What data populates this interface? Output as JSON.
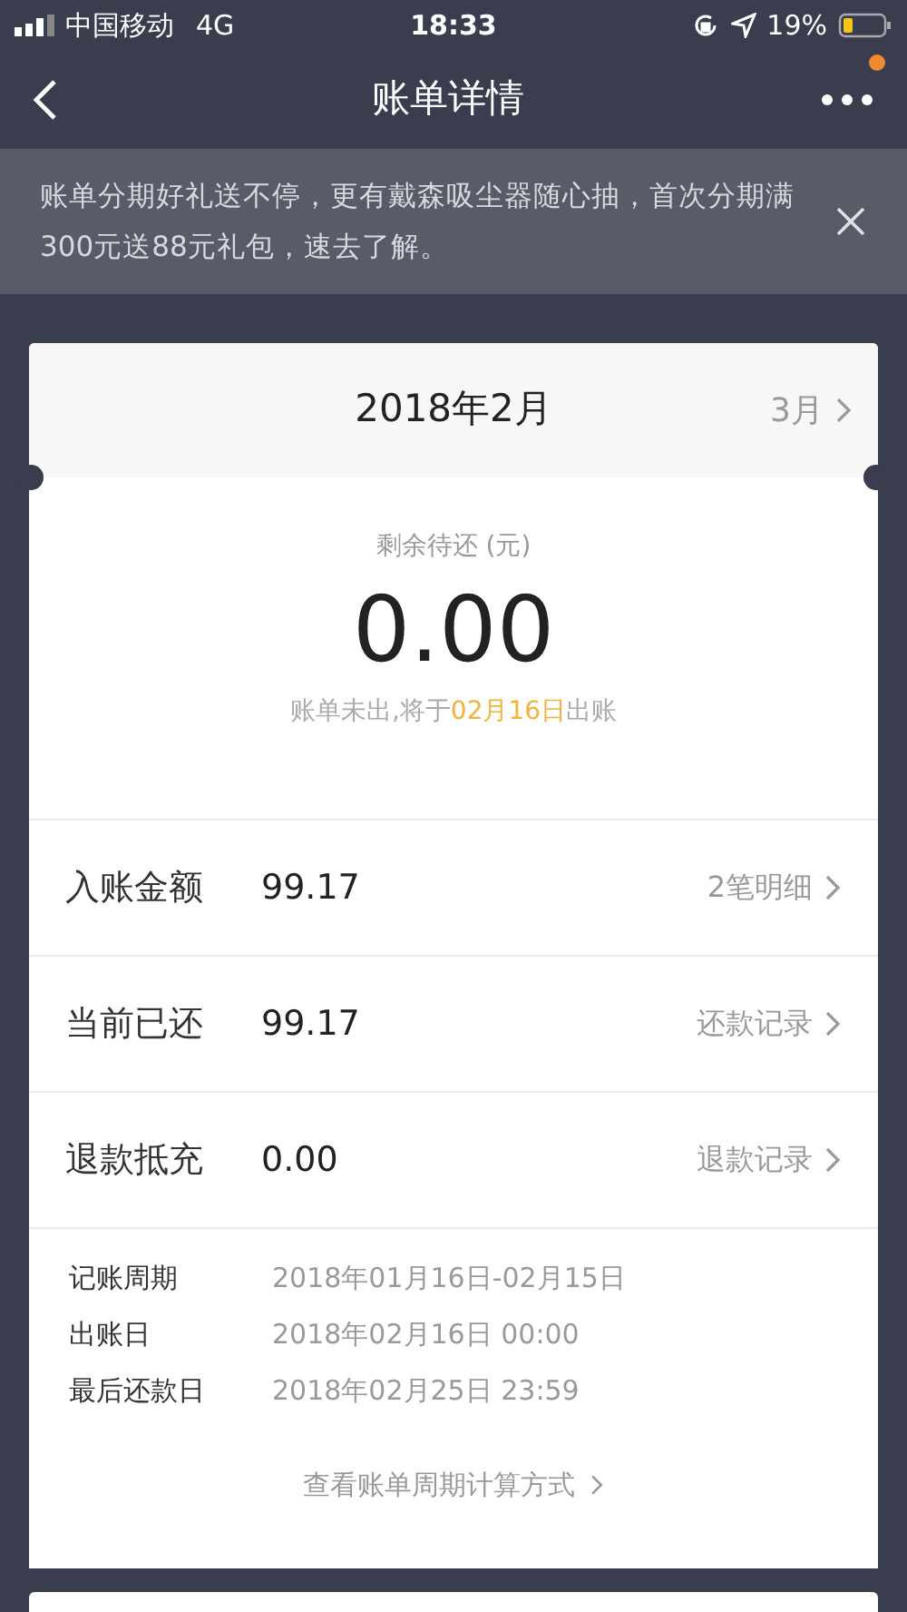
{
  "status_bar": {
    "carrier": "中国移动",
    "network": "4G",
    "time": "18:33",
    "battery": "19%"
  },
  "nav": {
    "title": "账单详情",
    "more_has_badge": true
  },
  "banner": {
    "text": "账单分期好礼送不停，更有戴森吸尘器随心抽，首次分期满300元送88元礼包，速去了解。"
  },
  "month": {
    "current": "2018年2月",
    "next": "3月"
  },
  "summary": {
    "label": "剩余待还 (元)",
    "amount": "0.00",
    "note_prefix": "账单未出,将于",
    "note_date": "02月16日",
    "note_suffix": "出账"
  },
  "rows": [
    {
      "label": "入账金额",
      "value": "99.17",
      "link": "2笔明细"
    },
    {
      "label": "当前已还",
      "value": "99.17",
      "link": "还款记录"
    },
    {
      "label": "退款抵充",
      "value": "0.00",
      "link": "退款记录"
    }
  ],
  "details": [
    {
      "label": "记账周期",
      "value": "2018年01月16日-02月15日"
    },
    {
      "label": "出账日",
      "value": "2018年02月16日 00:00"
    },
    {
      "label": "最后还款日",
      "value": "2018年02月25日 23:59"
    }
  ],
  "footer_link": "查看账单周期计算方式"
}
